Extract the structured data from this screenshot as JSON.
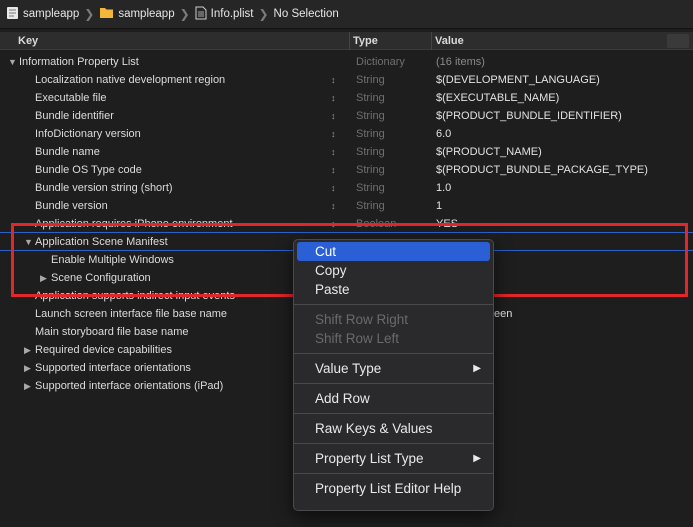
{
  "breadcrumb": {
    "items": [
      {
        "label": "sampleapp",
        "icon": "project-icon"
      },
      {
        "label": "sampleapp",
        "icon": "folder-icon"
      },
      {
        "label": "Info.plist",
        "icon": "file-icon"
      },
      {
        "label": "No Selection",
        "icon": ""
      }
    ]
  },
  "header": {
    "key": "Key",
    "type": "Type",
    "value": "Value"
  },
  "rows": [
    {
      "key": "Information Property List",
      "type": "Dictionary",
      "value": "(16 items)"
    },
    {
      "key": "Localization native development region",
      "type": "String",
      "value": "$(DEVELOPMENT_LANGUAGE)"
    },
    {
      "key": "Executable file",
      "type": "String",
      "value": "$(EXECUTABLE_NAME)"
    },
    {
      "key": "Bundle identifier",
      "type": "String",
      "value": "$(PRODUCT_BUNDLE_IDENTIFIER)"
    },
    {
      "key": "InfoDictionary version",
      "type": "String",
      "value": "6.0"
    },
    {
      "key": "Bundle name",
      "type": "String",
      "value": "$(PRODUCT_NAME)"
    },
    {
      "key": "Bundle OS Type code",
      "type": "String",
      "value": "$(PRODUCT_BUNDLE_PACKAGE_TYPE)"
    },
    {
      "key": "Bundle version string (short)",
      "type": "String",
      "value": "1.0"
    },
    {
      "key": "Bundle version",
      "type": "String",
      "value": "1"
    },
    {
      "key": "Application requires iPhone environment",
      "type": "Boolean",
      "value": "YES"
    },
    {
      "key": "Application Scene Manifest",
      "type": "",
      "value": ""
    },
    {
      "key": "Enable Multiple Windows",
      "type": "",
      "value": ""
    },
    {
      "key": "Scene Configuration",
      "type": "",
      "value": ""
    },
    {
      "key": "Application supports indirect input events",
      "type": "",
      "value": ""
    },
    {
      "key": "Launch screen interface file base name",
      "type": "",
      "value": "een"
    },
    {
      "key": "Main storyboard file base name",
      "type": "",
      "value": ""
    },
    {
      "key": "Required device capabilities",
      "type": "",
      "value": ""
    },
    {
      "key": "Supported interface orientations",
      "type": "",
      "value": ""
    },
    {
      "key": "Supported interface orientations (iPad)",
      "type": "",
      "value": ""
    }
  ],
  "context_menu": {
    "cut": "Cut",
    "copy": "Copy",
    "paste": "Paste",
    "shift_right": "Shift Row Right",
    "shift_left": "Shift Row Left",
    "value_type": "Value Type",
    "add_row": "Add Row",
    "raw_keys": "Raw Keys & Values",
    "plist_type": "Property List Type",
    "help": "Property List Editor Help"
  },
  "colors": {
    "highlight": "#2b5fd6",
    "annotation": "#e2262a",
    "selection_line": "#2a62c9"
  }
}
